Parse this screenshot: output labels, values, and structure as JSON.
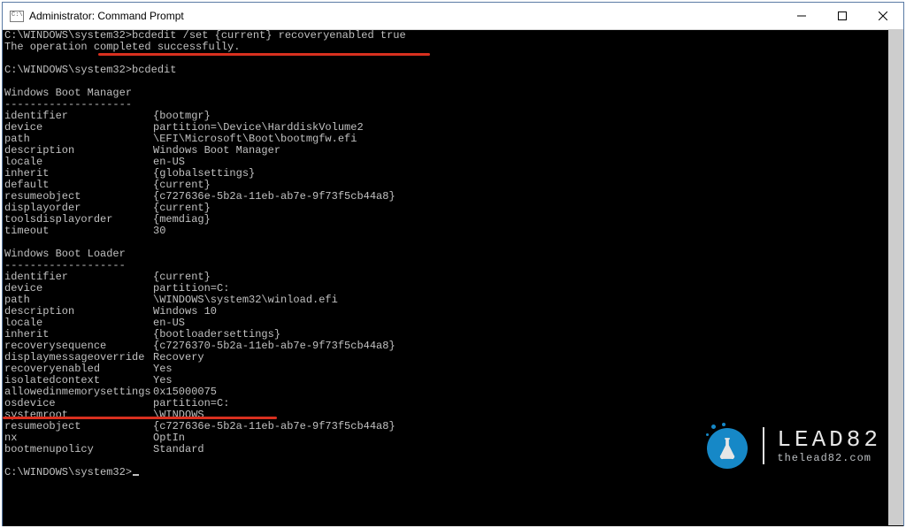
{
  "title": "Administrator: Command Prompt",
  "prompt_path": "C:\\WINDOWS\\system32>",
  "cmd1": "bcdedit /set {current} recoveryenabled true",
  "cmd1_result": "The operation completed successfully.",
  "cmd2": "bcdedit",
  "sections": {
    "boot_manager": {
      "heading": "Windows Boot Manager",
      "rule": "--------------------",
      "rows": [
        {
          "k": "identifier",
          "v": "{bootmgr}"
        },
        {
          "k": "device",
          "v": "partition=\\Device\\HarddiskVolume2"
        },
        {
          "k": "path",
          "v": "\\EFI\\Microsoft\\Boot\\bootmgfw.efi"
        },
        {
          "k": "description",
          "v": "Windows Boot Manager"
        },
        {
          "k": "locale",
          "v": "en-US"
        },
        {
          "k": "inherit",
          "v": "{globalsettings}"
        },
        {
          "k": "default",
          "v": "{current}"
        },
        {
          "k": "resumeobject",
          "v": "{c727636e-5b2a-11eb-ab7e-9f73f5cb44a8}"
        },
        {
          "k": "displayorder",
          "v": "{current}"
        },
        {
          "k": "toolsdisplayorder",
          "v": "{memdiag}"
        },
        {
          "k": "timeout",
          "v": "30"
        }
      ]
    },
    "boot_loader": {
      "heading": "Windows Boot Loader",
      "rule": "-------------------",
      "rows": [
        {
          "k": "identifier",
          "v": "{current}"
        },
        {
          "k": "device",
          "v": "partition=C:"
        },
        {
          "k": "path",
          "v": "\\WINDOWS\\system32\\winload.efi"
        },
        {
          "k": "description",
          "v": "Windows 10"
        },
        {
          "k": "locale",
          "v": "en-US"
        },
        {
          "k": "inherit",
          "v": "{bootloadersettings}"
        },
        {
          "k": "recoverysequence",
          "v": "{c7276370-5b2a-11eb-ab7e-9f73f5cb44a8}"
        },
        {
          "k": "displaymessageoverride",
          "v": "Recovery"
        },
        {
          "k": "recoveryenabled",
          "v": "Yes"
        },
        {
          "k": "isolatedcontext",
          "v": "Yes"
        },
        {
          "k": "allowedinmemorysettings",
          "v": "0x15000075"
        },
        {
          "k": "osdevice",
          "v": "partition=C:"
        },
        {
          "k": "systemroot",
          "v": "\\WINDOWS"
        },
        {
          "k": "resumeobject",
          "v": "{c727636e-5b2a-11eb-ab7e-9f73f5cb44a8}"
        },
        {
          "k": "nx",
          "v": "OptIn"
        },
        {
          "k": "bootmenupolicy",
          "v": "Standard"
        }
      ]
    }
  },
  "watermark": {
    "brand": "LEAD82",
    "url": "thelead82.com"
  }
}
